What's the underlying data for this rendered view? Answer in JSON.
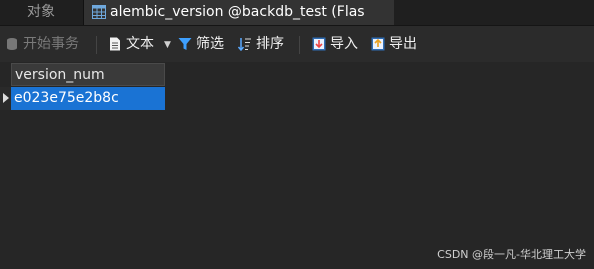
{
  "tabs": {
    "inactive_label": "对象",
    "active_label": "alembic_version @backdb_test (Flas"
  },
  "toolbar": {
    "begin_transaction": "开始事务",
    "text": "文本",
    "filter": "筛选",
    "sort": "排序",
    "import": "导入",
    "export": "导出"
  },
  "grid": {
    "columns": [
      "version_num"
    ],
    "rows": [
      [
        "e023e75e2b8c"
      ]
    ]
  },
  "watermark": "CSDN @段一凡-华北理工大学",
  "colors": {
    "selection": "#1a73d4",
    "background": "#262626"
  }
}
